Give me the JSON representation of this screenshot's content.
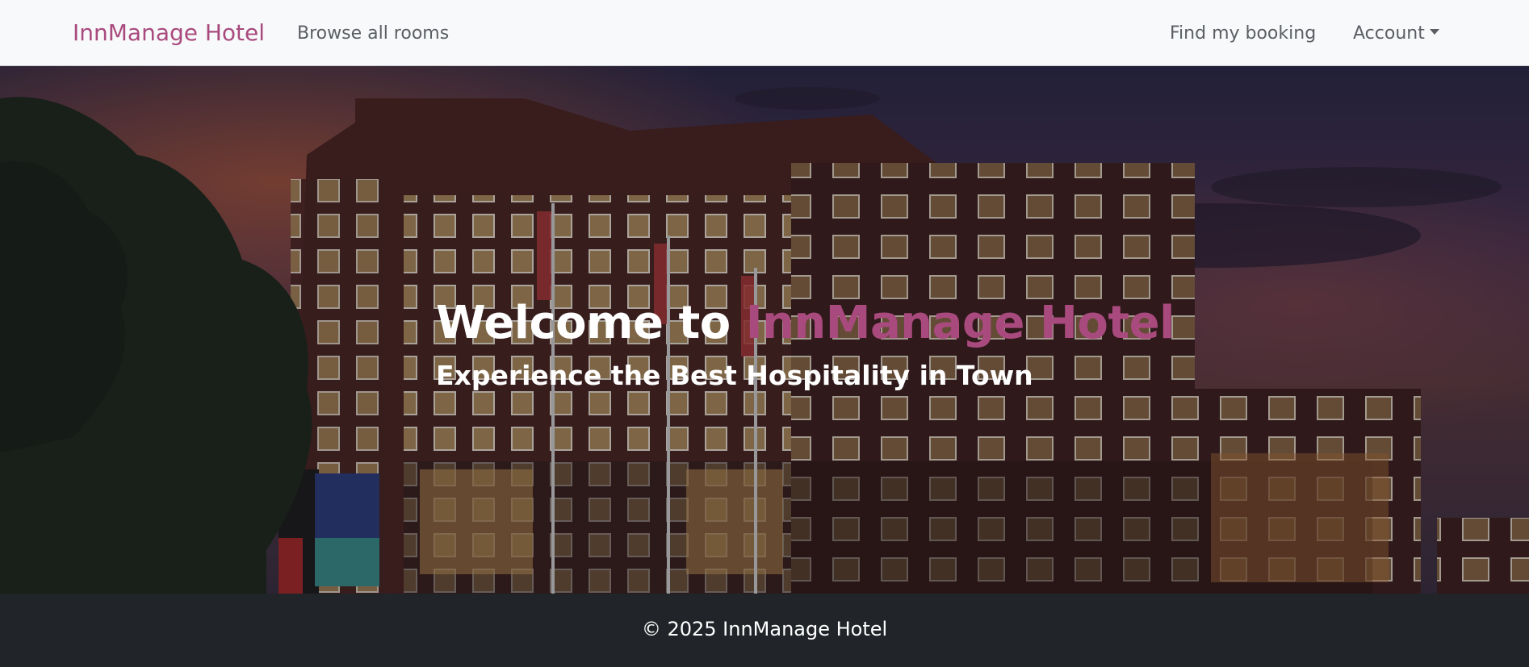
{
  "navbar": {
    "brand": "InnManage Hotel",
    "links": {
      "browse": "Browse all rooms",
      "find_booking": "Find my booking",
      "account": "Account"
    }
  },
  "hero": {
    "title_prefix": "Welcome to ",
    "title_accent": "InnManage Hotel",
    "subtitle": "Experience the Best Hospitality in Town"
  },
  "footer": {
    "text": "© 2025 InnManage Hotel"
  },
  "colors": {
    "brand_accent": "#a94a7e",
    "navbar_bg": "#f8f9fa",
    "footer_bg": "#212529"
  },
  "icons": {
    "account_dropdown": "caret-down-icon"
  }
}
